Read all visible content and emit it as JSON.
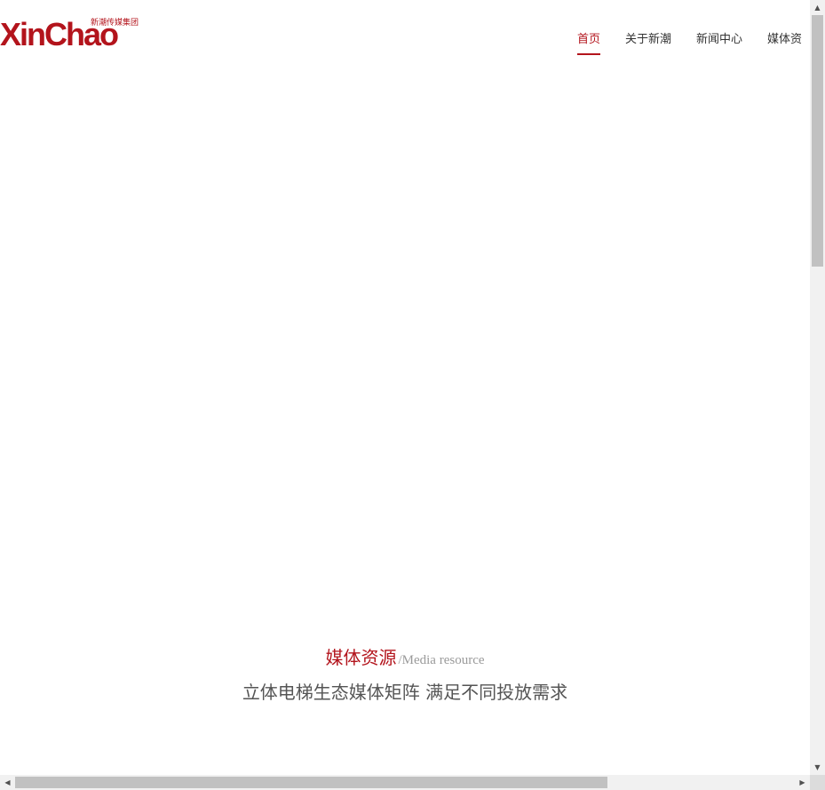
{
  "brand": {
    "logo_text": "XinChao",
    "logo_subtitle": "新潮传媒集团",
    "color": "#b3141c"
  },
  "nav": {
    "items": [
      {
        "label": "首页",
        "active": true
      },
      {
        "label": "关于新潮",
        "active": false
      },
      {
        "label": "新闻中心",
        "active": false
      },
      {
        "label": "媒体资",
        "active": false
      }
    ]
  },
  "section": {
    "title": "媒体资源",
    "title_en": "/Media resource",
    "subtitle": "立体电梯生态媒体矩阵 满足不同投放需求"
  },
  "scrollbars": {
    "up_icon": "arrow-up-icon",
    "down_icon": "arrow-down-icon",
    "left_icon": "arrow-left-icon",
    "right_icon": "arrow-right-icon"
  }
}
